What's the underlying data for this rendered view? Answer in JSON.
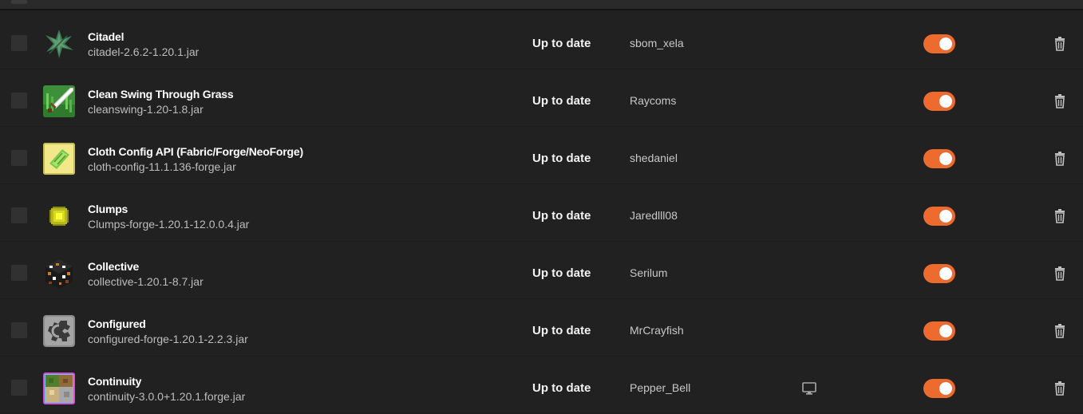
{
  "colors": {
    "background": "#212121",
    "accent_toggle": "#ee6b2f",
    "text_primary": "#ffffff",
    "text_secondary": "#bdbdbd"
  },
  "mods": [
    {
      "name": "Citadel",
      "file": "citadel-2.6.2-1.20.1.jar",
      "status": "Up to date",
      "author": "sbom_xela",
      "enabled": true,
      "icon": "citadel-leaf-icon",
      "side_icon": null
    },
    {
      "name": "Clean Swing Through Grass",
      "file": "cleanswing-1.20-1.8.jar",
      "status": "Up to date",
      "author": "Raycoms",
      "enabled": true,
      "icon": "sword-in-grass-icon",
      "side_icon": null
    },
    {
      "name": "Cloth Config API (Fabric/Forge/NeoForge)",
      "file": "cloth-config-11.1.136-forge.jar",
      "status": "Up to date",
      "author": "shedaniel",
      "enabled": true,
      "icon": "cloth-config-icon",
      "side_icon": null
    },
    {
      "name": "Clumps",
      "file": "Clumps-forge-1.20.1-12.0.0.4.jar",
      "status": "Up to date",
      "author": "Jaredlll08",
      "enabled": true,
      "icon": "xp-orb-icon",
      "side_icon": null
    },
    {
      "name": "Collective",
      "file": "collective-1.20.1-8.7.jar",
      "status": "Up to date",
      "author": "Serilum",
      "enabled": true,
      "icon": "collective-block-icon",
      "side_icon": null
    },
    {
      "name": "Configured",
      "file": "configured-forge-1.20.1-2.2.3.jar",
      "status": "Up to date",
      "author": "MrCrayfish",
      "enabled": true,
      "icon": "configured-gear-icon",
      "side_icon": null
    },
    {
      "name": "Continuity",
      "file": "continuity-3.0.0+1.20.1.forge.jar",
      "status": "Up to date",
      "author": "Pepper_Bell",
      "enabled": true,
      "icon": "continuity-blocks-icon",
      "side_icon": "client-monitor-icon"
    }
  ]
}
